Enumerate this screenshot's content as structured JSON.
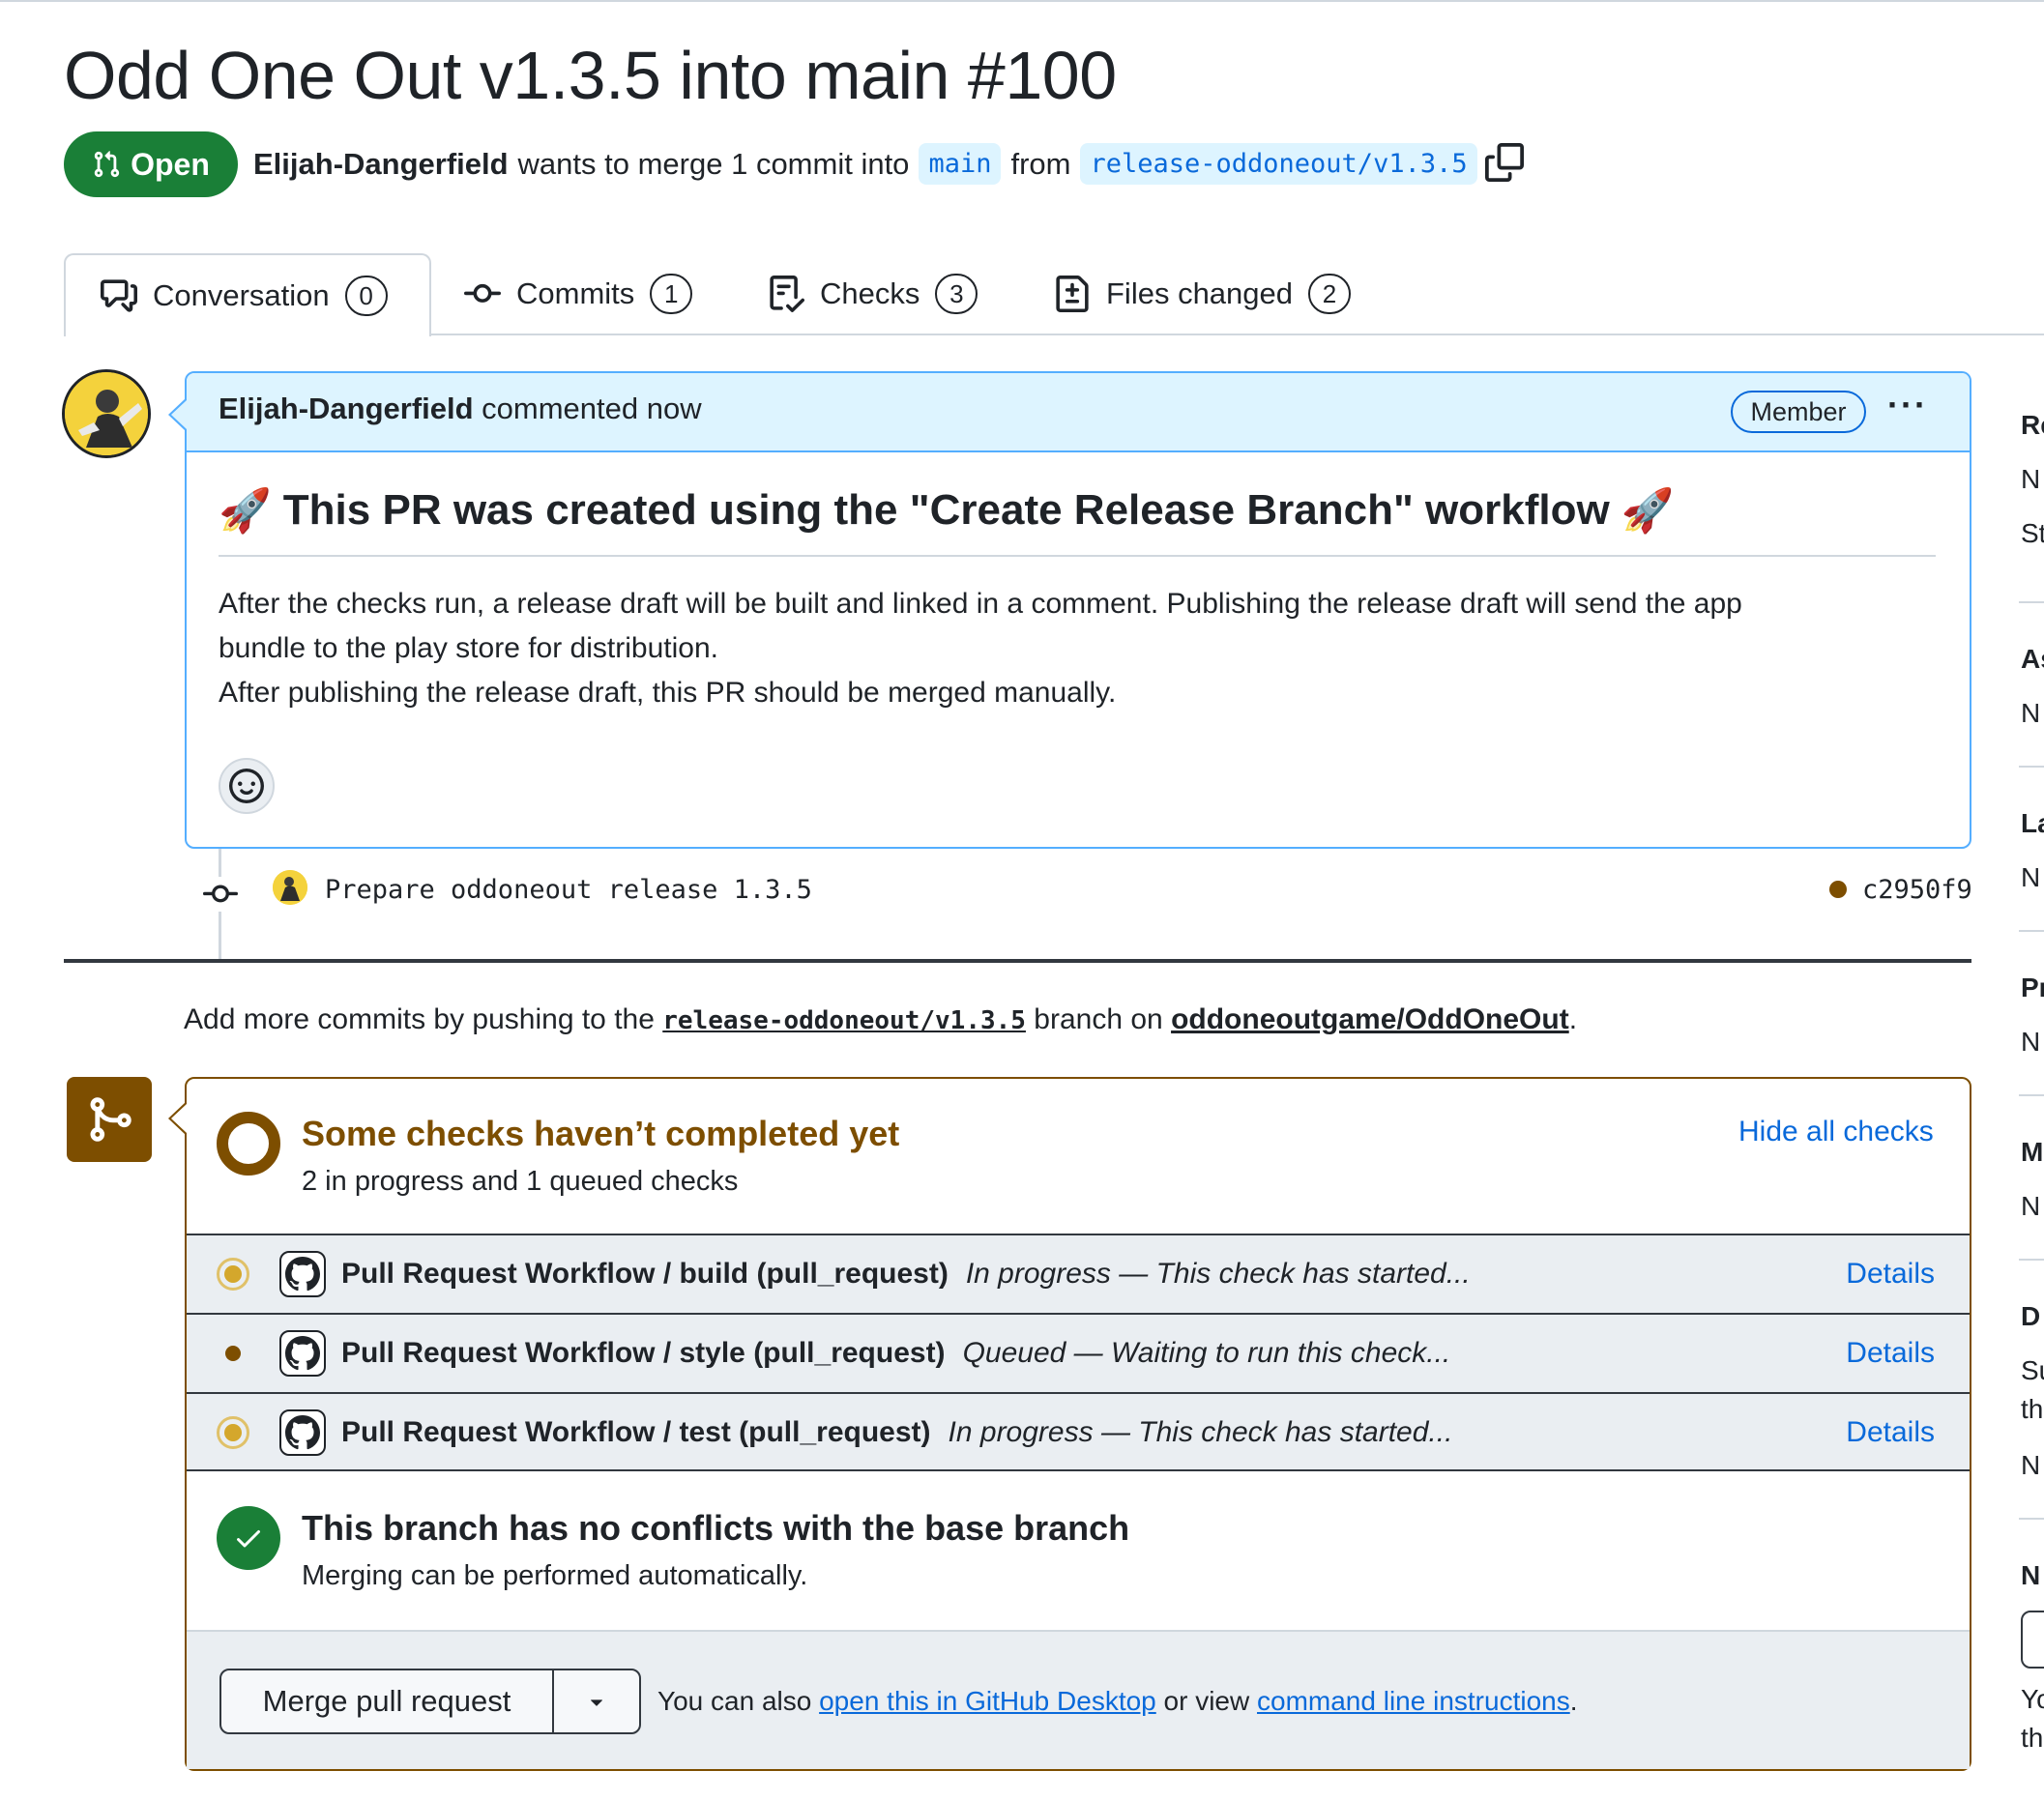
{
  "pr": {
    "title": "Odd One Out v1.3.5 into main #100",
    "state": "Open",
    "author": "Elijah-Dangerfield",
    "merge_text": "wants to merge 1 commit into",
    "base_branch": "main",
    "from_text": "from",
    "head_branch": "release-oddoneout/v1.3.5"
  },
  "tabs": [
    {
      "label": "Conversation",
      "count": "0"
    },
    {
      "label": "Commits",
      "count": "1"
    },
    {
      "label": "Checks",
      "count": "3"
    },
    {
      "label": "Files changed",
      "count": "2"
    }
  ],
  "comment": {
    "author": "Elijah-Dangerfield",
    "action": "commented now",
    "badge": "Member",
    "heading_emoji": "🚀",
    "heading": "This PR was created using the \"Create Release Branch\" workflow",
    "body_lines": [
      "After the checks run, a release draft will be built and linked in a comment. Publishing the release draft will send the app",
      "bundle to the play store for distribution.",
      "After publishing the release draft, this PR should be merged manually."
    ]
  },
  "commit": {
    "message": "Prepare oddoneout release 1.3.5",
    "sha": "c2950f9"
  },
  "push_hint": {
    "prefix": "Add more commits by pushing to the",
    "branch": "release-oddoneout/v1.3.5",
    "middle": "branch on",
    "repo": "oddoneoutgame/OddOneOut",
    "suffix": "."
  },
  "checks": {
    "title": "Some checks haven’t completed yet",
    "subtitle": "2 in progress and 1 queued checks",
    "hide_label": "Hide all checks",
    "items": [
      {
        "name": "Pull Request Workflow / build (pull_request)",
        "status": "in_progress",
        "description": "In progress — This check has started...",
        "details": "Details"
      },
      {
        "name": "Pull Request Workflow / style (pull_request)",
        "status": "queued",
        "description": "Queued — Waiting to run this check...",
        "details": "Details"
      },
      {
        "name": "Pull Request Workflow / test (pull_request)",
        "status": "in_progress",
        "description": "In progress — This check has started...",
        "details": "Details"
      }
    ]
  },
  "conflicts": {
    "title": "This branch has no conflicts with the base branch",
    "subtitle": "Merging can be performed automatically."
  },
  "merge": {
    "button": "Merge pull request",
    "footer_prefix": "You can also",
    "desktop_link": "open this in GitHub Desktop",
    "footer_middle": "or view",
    "cli_link": "command line instructions",
    "footer_suffix": "."
  },
  "sidebar_fragments": [
    "Re",
    "N",
    "St",
    "As",
    "N",
    "La",
    "N",
    "Pr",
    "N",
    "M",
    "N",
    "D",
    "Su",
    "th",
    "N",
    "N",
    "Yo",
    "th"
  ],
  "colors": {
    "open_green": "#1a7f37",
    "link_blue": "#0969da",
    "pending_brown": "#7d4e00",
    "comment_header_bg": "#ddf4ff",
    "progress_yellow": "#d4a72c"
  },
  "icons": [
    "git-pull-request-icon",
    "copy-icon",
    "comment-discussion-icon",
    "git-commit-icon",
    "checklist-icon",
    "file-diff-icon",
    "kebab-horizontal-icon",
    "smiley-icon",
    "git-merge-icon",
    "github-mark-icon",
    "check-icon",
    "triangle-down-icon"
  ]
}
